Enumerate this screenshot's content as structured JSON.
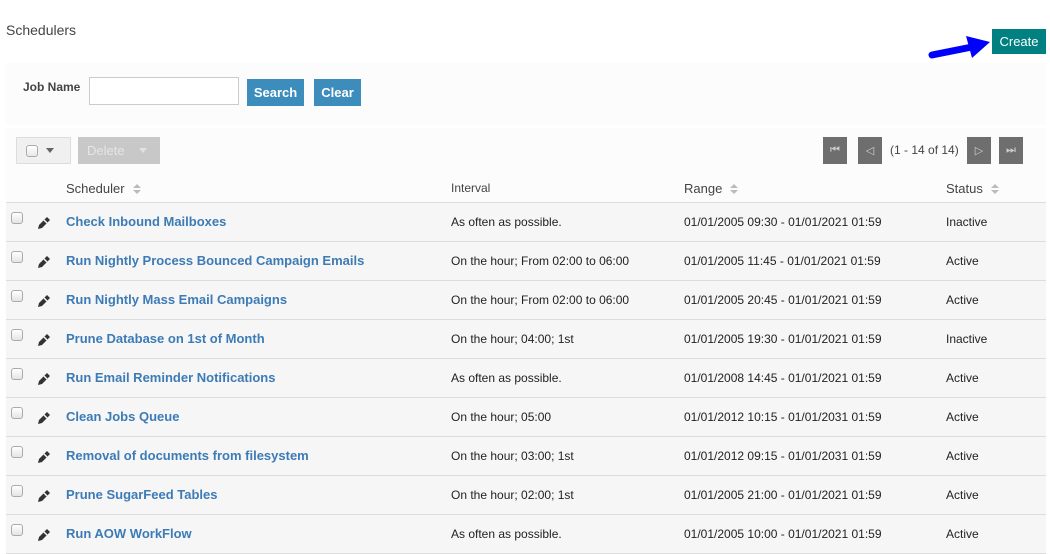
{
  "page": {
    "title": "Schedulers",
    "create_label": "Create"
  },
  "search": {
    "job_name_label": "Job Name",
    "job_name_value": "",
    "job_name_placeholder": "",
    "search_label": "Search",
    "clear_label": "Clear"
  },
  "actions": {
    "delete_label": "Delete"
  },
  "pagination": {
    "text": "(1 - 14 of 14)",
    "first_icon": "first-page-icon",
    "prev_icon": "prev-page-icon",
    "next_icon": "next-page-icon",
    "last_icon": "last-page-icon"
  },
  "columns": {
    "scheduler": "Scheduler",
    "interval": "Interval",
    "range": "Range",
    "status": "Status"
  },
  "colors": {
    "accent_teal": "#008080",
    "button_blue": "#3c8dbc",
    "link_blue": "#3c7bb6",
    "annotation_arrow": "#0000ff"
  },
  "rows": [
    {
      "name": "Check Inbound Mailboxes",
      "interval": "As often as possible.",
      "range": "01/01/2005 09:30 - 01/01/2021 01:59",
      "status": "Inactive"
    },
    {
      "name": "Run Nightly Process Bounced Campaign Emails",
      "interval": "On the hour; From 02:00 to 06:00",
      "range": "01/01/2005 11:45 - 01/01/2021 01:59",
      "status": "Active"
    },
    {
      "name": "Run Nightly Mass Email Campaigns",
      "interval": "On the hour; From 02:00 to 06:00",
      "range": "01/01/2005 20:45 - 01/01/2021 01:59",
      "status": "Active"
    },
    {
      "name": "Prune Database on 1st of Month",
      "interval": "On the hour; 04:00; 1st",
      "range": "01/01/2005 19:30 - 01/01/2021 01:59",
      "status": "Inactive"
    },
    {
      "name": "Run Email Reminder Notifications",
      "interval": "As often as possible.",
      "range": "01/01/2008 14:45 - 01/01/2021 01:59",
      "status": "Active"
    },
    {
      "name": "Clean Jobs Queue",
      "interval": "On the hour; 05:00",
      "range": "01/01/2012 10:15 - 01/01/2031 01:59",
      "status": "Active"
    },
    {
      "name": "Removal of documents from filesystem",
      "interval": "On the hour; 03:00; 1st",
      "range": "01/01/2012 09:15 - 01/01/2031 01:59",
      "status": "Active"
    },
    {
      "name": "Prune SugarFeed Tables",
      "interval": "On the hour; 02:00; 1st",
      "range": "01/01/2005 21:00 - 01/01/2021 01:59",
      "status": "Active"
    },
    {
      "name": "Run AOW WorkFlow",
      "interval": "As often as possible.",
      "range": "01/01/2005 10:00 - 01/01/2021 01:59",
      "status": "Active"
    }
  ]
}
